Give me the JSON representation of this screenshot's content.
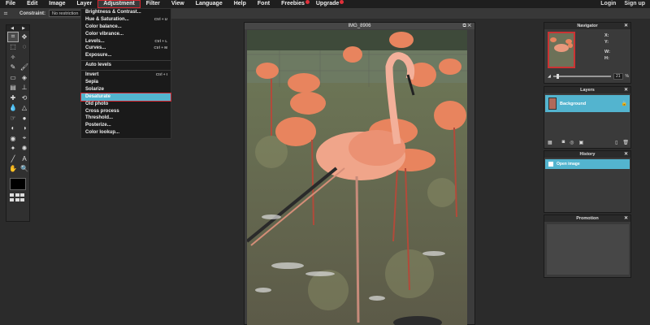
{
  "menubar": {
    "items": [
      "File",
      "Edit",
      "Image",
      "Layer",
      "Adjustment",
      "Filter",
      "View",
      "Language",
      "Help",
      "Font",
      "Freebies",
      "Upgrade"
    ],
    "active": "Adjustment",
    "right": [
      "Login",
      "Sign up"
    ]
  },
  "optionsbar": {
    "constraint_label": "Constraint:",
    "constraint_value": "No restriction"
  },
  "adjustment_menu": [
    {
      "label": "Brightness & Contrast...",
      "shortcut": ""
    },
    {
      "label": "Hue & Saturation...",
      "shortcut": "Ctrl + U"
    },
    {
      "label": "Color balance...",
      "shortcut": ""
    },
    {
      "label": "Color vibrance...",
      "shortcut": ""
    },
    {
      "label": "Levels...",
      "shortcut": "Ctrl + L"
    },
    {
      "label": "Curves...",
      "shortcut": "Ctrl + M"
    },
    {
      "label": "Exposure...",
      "shortcut": ""
    },
    {
      "label": "Auto levels",
      "shortcut": ""
    },
    {
      "label": "Invert",
      "shortcut": "Ctrl + I"
    },
    {
      "label": "Sepia",
      "shortcut": ""
    },
    {
      "label": "Solarize",
      "shortcut": ""
    },
    {
      "label": "Desaturate",
      "shortcut": "",
      "highlighted": true
    },
    {
      "label": "Old photo",
      "shortcut": ""
    },
    {
      "label": "Cross process",
      "shortcut": ""
    },
    {
      "label": "Threshold...",
      "shortcut": ""
    },
    {
      "label": "Posterize...",
      "shortcut": ""
    },
    {
      "label": "Color lookup...",
      "shortcut": ""
    }
  ],
  "document": {
    "title": "IMG_8906"
  },
  "navigator": {
    "title": "Navigator",
    "labels": [
      "X:",
      "Y:",
      "W:",
      "H:"
    ],
    "zoom": "21",
    "zoom_unit": "%"
  },
  "layers": {
    "title": "Layers",
    "items": [
      {
        "name": "Background"
      }
    ]
  },
  "history": {
    "title": "History",
    "items": [
      {
        "name": "Open image"
      }
    ]
  },
  "promotion": {
    "title": "Promotion"
  },
  "colors": {
    "accent": "#53b4cf",
    "highlight_border": "#d8252f",
    "badge": "#e0303a"
  }
}
